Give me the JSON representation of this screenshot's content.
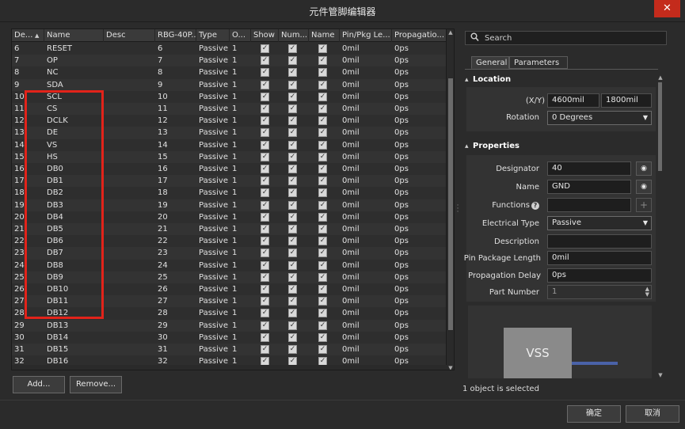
{
  "window": {
    "title": "元件管脚编辑器",
    "close_glyph": "✕"
  },
  "table": {
    "columns": [
      "De...",
      "Name",
      "Desc",
      "RBG-40P...",
      "Type",
      "O...",
      "Show",
      "Num...",
      "Name",
      "Pin/Pkg Le...",
      "Propagatio..."
    ],
    "rows": [
      {
        "des": "6",
        "name": "RESET",
        "desc": "",
        "rbg": "6",
        "type": "Passive",
        "o": "1",
        "len": "0mil",
        "prop": "0ps"
      },
      {
        "des": "7",
        "name": "OP",
        "desc": "",
        "rbg": "7",
        "type": "Passive",
        "o": "1",
        "len": "0mil",
        "prop": "0ps"
      },
      {
        "des": "8",
        "name": "NC",
        "desc": "",
        "rbg": "8",
        "type": "Passive",
        "o": "1",
        "len": "0mil",
        "prop": "0ps"
      },
      {
        "des": "9",
        "name": "SDA",
        "desc": "",
        "rbg": "9",
        "type": "Passive",
        "o": "1",
        "len": "0mil",
        "prop": "0ps"
      },
      {
        "des": "10",
        "name": "SCL",
        "desc": "",
        "rbg": "10",
        "type": "Passive",
        "o": "1",
        "len": "0mil",
        "prop": "0ps"
      },
      {
        "des": "11",
        "name": "CS",
        "desc": "",
        "rbg": "11",
        "type": "Passive",
        "o": "1",
        "len": "0mil",
        "prop": "0ps"
      },
      {
        "des": "12",
        "name": "DCLK",
        "desc": "",
        "rbg": "12",
        "type": "Passive",
        "o": "1",
        "len": "0mil",
        "prop": "0ps"
      },
      {
        "des": "13",
        "name": "DE",
        "desc": "",
        "rbg": "13",
        "type": "Passive",
        "o": "1",
        "len": "0mil",
        "prop": "0ps"
      },
      {
        "des": "14",
        "name": "VS",
        "desc": "",
        "rbg": "14",
        "type": "Passive",
        "o": "1",
        "len": "0mil",
        "prop": "0ps"
      },
      {
        "des": "15",
        "name": "HS",
        "desc": "",
        "rbg": "15",
        "type": "Passive",
        "o": "1",
        "len": "0mil",
        "prop": "0ps"
      },
      {
        "des": "16",
        "name": "DB0",
        "desc": "",
        "rbg": "16",
        "type": "Passive",
        "o": "1",
        "len": "0mil",
        "prop": "0ps"
      },
      {
        "des": "17",
        "name": "DB1",
        "desc": "",
        "rbg": "17",
        "type": "Passive",
        "o": "1",
        "len": "0mil",
        "prop": "0ps"
      },
      {
        "des": "18",
        "name": "DB2",
        "desc": "",
        "rbg": "18",
        "type": "Passive",
        "o": "1",
        "len": "0mil",
        "prop": "0ps"
      },
      {
        "des": "19",
        "name": "DB3",
        "desc": "",
        "rbg": "19",
        "type": "Passive",
        "o": "1",
        "len": "0mil",
        "prop": "0ps"
      },
      {
        "des": "20",
        "name": "DB4",
        "desc": "",
        "rbg": "20",
        "type": "Passive",
        "o": "1",
        "len": "0mil",
        "prop": "0ps"
      },
      {
        "des": "21",
        "name": "DB5",
        "desc": "",
        "rbg": "21",
        "type": "Passive",
        "o": "1",
        "len": "0mil",
        "prop": "0ps"
      },
      {
        "des": "22",
        "name": "DB6",
        "desc": "",
        "rbg": "22",
        "type": "Passive",
        "o": "1",
        "len": "0mil",
        "prop": "0ps"
      },
      {
        "des": "23",
        "name": "DB7",
        "desc": "",
        "rbg": "23",
        "type": "Passive",
        "o": "1",
        "len": "0mil",
        "prop": "0ps"
      },
      {
        "des": "24",
        "name": "DB8",
        "desc": "",
        "rbg": "24",
        "type": "Passive",
        "o": "1",
        "len": "0mil",
        "prop": "0ps"
      },
      {
        "des": "25",
        "name": "DB9",
        "desc": "",
        "rbg": "25",
        "type": "Passive",
        "o": "1",
        "len": "0mil",
        "prop": "0ps"
      },
      {
        "des": "26",
        "name": "DB10",
        "desc": "",
        "rbg": "26",
        "type": "Passive",
        "o": "1",
        "len": "0mil",
        "prop": "0ps"
      },
      {
        "des": "27",
        "name": "DB11",
        "desc": "",
        "rbg": "27",
        "type": "Passive",
        "o": "1",
        "len": "0mil",
        "prop": "0ps"
      },
      {
        "des": "28",
        "name": "DB12",
        "desc": "",
        "rbg": "28",
        "type": "Passive",
        "o": "1",
        "len": "0mil",
        "prop": "0ps"
      },
      {
        "des": "29",
        "name": "DB13",
        "desc": "",
        "rbg": "29",
        "type": "Passive",
        "o": "1",
        "len": "0mil",
        "prop": "0ps"
      },
      {
        "des": "30",
        "name": "DB14",
        "desc": "",
        "rbg": "30",
        "type": "Passive",
        "o": "1",
        "len": "0mil",
        "prop": "0ps"
      },
      {
        "des": "31",
        "name": "DB15",
        "desc": "",
        "rbg": "31",
        "type": "Passive",
        "o": "1",
        "len": "0mil",
        "prop": "0ps"
      },
      {
        "des": "32",
        "name": "DB16",
        "desc": "",
        "rbg": "32",
        "type": "Passive",
        "o": "1",
        "len": "0mil",
        "prop": "0ps"
      }
    ],
    "check_glyph": "✓",
    "highlight_color": "#e2231a"
  },
  "buttons": {
    "add_label": "Add...",
    "remove_label": "Remove...",
    "ok_label": "确定",
    "cancel_label": "取消"
  },
  "panel": {
    "search_placeholder": "Search",
    "tabs": [
      "General",
      "Parameters"
    ],
    "location": {
      "header": "Location",
      "xy_label": "(X/Y)",
      "x_value": "4600mil",
      "y_value": "1800mil",
      "rotation_label": "Rotation",
      "rotation_value": "0 Degrees"
    },
    "properties": {
      "header": "Properties",
      "designator_label": "Designator",
      "designator_value": "40",
      "name_label": "Name",
      "name_value": "GND",
      "functions_label": "Functions",
      "functions_value": "",
      "electrical_type_label": "Electrical Type",
      "electrical_type_value": "Passive",
      "description_label": "Description",
      "description_value": "",
      "pin_length_label": "Pin Package Length",
      "pin_length_value": "0mil",
      "prop_delay_label": "Propagation Delay",
      "prop_delay_value": "0ps",
      "part_number_label": "Part Number",
      "part_number_value": "1"
    },
    "preview": {
      "symbol_label": "VSS"
    }
  },
  "status": {
    "selection_text": "1 object is selected"
  }
}
